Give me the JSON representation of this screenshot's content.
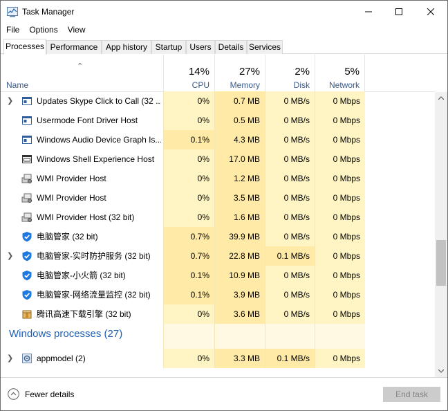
{
  "window": {
    "title": "Task Manager"
  },
  "menu": [
    "File",
    "Options",
    "View"
  ],
  "tabs": [
    {
      "label": "Processes",
      "active": true
    },
    {
      "label": "Performance"
    },
    {
      "label": "App history"
    },
    {
      "label": "Startup"
    },
    {
      "label": "Users"
    },
    {
      "label": "Details"
    },
    {
      "label": "Services"
    }
  ],
  "header": {
    "name": "Name",
    "cpu": {
      "pct": "14%",
      "label": "CPU"
    },
    "memory": {
      "pct": "27%",
      "label": "Memory"
    },
    "disk": {
      "pct": "2%",
      "label": "Disk"
    },
    "network": {
      "pct": "5%",
      "label": "Network"
    }
  },
  "rows": [
    {
      "expand": true,
      "icon": "window-icon",
      "name": "Updates Skype Click to Call (32 ...",
      "cpu": "0%",
      "memory": "0.7 MB",
      "disk": "0 MB/s",
      "network": "0 Mbps"
    },
    {
      "expand": false,
      "icon": "window-icon",
      "name": "Usermode Font Driver Host",
      "cpu": "0%",
      "memory": "0.5 MB",
      "disk": "0 MB/s",
      "network": "0 Mbps"
    },
    {
      "expand": false,
      "icon": "window-icon",
      "name": "Windows Audio Device Graph Is...",
      "cpu": "0.1%",
      "memory": "4.3 MB",
      "disk": "0 MB/s",
      "network": "0 Mbps"
    },
    {
      "expand": false,
      "icon": "shell-icon",
      "name": "Windows Shell Experience Host",
      "cpu": "0%",
      "memory": "17.0 MB",
      "disk": "0 MB/s",
      "network": "0 Mbps"
    },
    {
      "expand": false,
      "icon": "wmi-icon",
      "name": "WMI Provider Host",
      "cpu": "0%",
      "memory": "1.2 MB",
      "disk": "0 MB/s",
      "network": "0 Mbps"
    },
    {
      "expand": false,
      "icon": "wmi-icon",
      "name": "WMI Provider Host",
      "cpu": "0%",
      "memory": "3.5 MB",
      "disk": "0 MB/s",
      "network": "0 Mbps"
    },
    {
      "expand": false,
      "icon": "wmi-icon",
      "name": "WMI Provider Host (32 bit)",
      "cpu": "0%",
      "memory": "1.6 MB",
      "disk": "0 MB/s",
      "network": "0 Mbps"
    },
    {
      "expand": false,
      "icon": "shield-icon",
      "name": "电脑管家 (32 bit)",
      "cpu": "0.7%",
      "memory": "39.9 MB",
      "disk": "0 MB/s",
      "network": "0 Mbps"
    },
    {
      "expand": true,
      "icon": "shield-icon",
      "name": "电脑管家-实时防护服务 (32 bit)",
      "cpu": "0.7%",
      "memory": "22.8 MB",
      "disk": "0.1 MB/s",
      "network": "0 Mbps"
    },
    {
      "expand": false,
      "icon": "shield-icon",
      "name": "电脑管家-小火箭 (32 bit)",
      "cpu": "0.1%",
      "memory": "10.9 MB",
      "disk": "0 MB/s",
      "network": "0 Mbps"
    },
    {
      "expand": false,
      "icon": "shield-icon",
      "name": "电脑管家-网络流量监控 (32 bit)",
      "cpu": "0.1%",
      "memory": "3.9 MB",
      "disk": "0 MB/s",
      "network": "0 Mbps"
    },
    {
      "expand": false,
      "icon": "package-icon",
      "name": "腾讯高速下载引擎 (32 bit)",
      "cpu": "0%",
      "memory": "3.6 MB",
      "disk": "0 MB/s",
      "network": "0 Mbps"
    }
  ],
  "group": {
    "title": "Windows processes (27)"
  },
  "after_rows": [
    {
      "expand": true,
      "icon": "gear-icon",
      "name": "appmodel (2)",
      "cpu": "0%",
      "memory": "3.3 MB",
      "disk": "0.1 MB/s",
      "network": "0 Mbps"
    }
  ],
  "footer": {
    "fewer_details": "Fewer details",
    "end_task": "End task"
  },
  "colors": {
    "cell_light": "#fff4c4",
    "cell_mid": "#ffeaa8",
    "group_blue": "#1f5fb5",
    "header_label": "#3a5a8c"
  }
}
